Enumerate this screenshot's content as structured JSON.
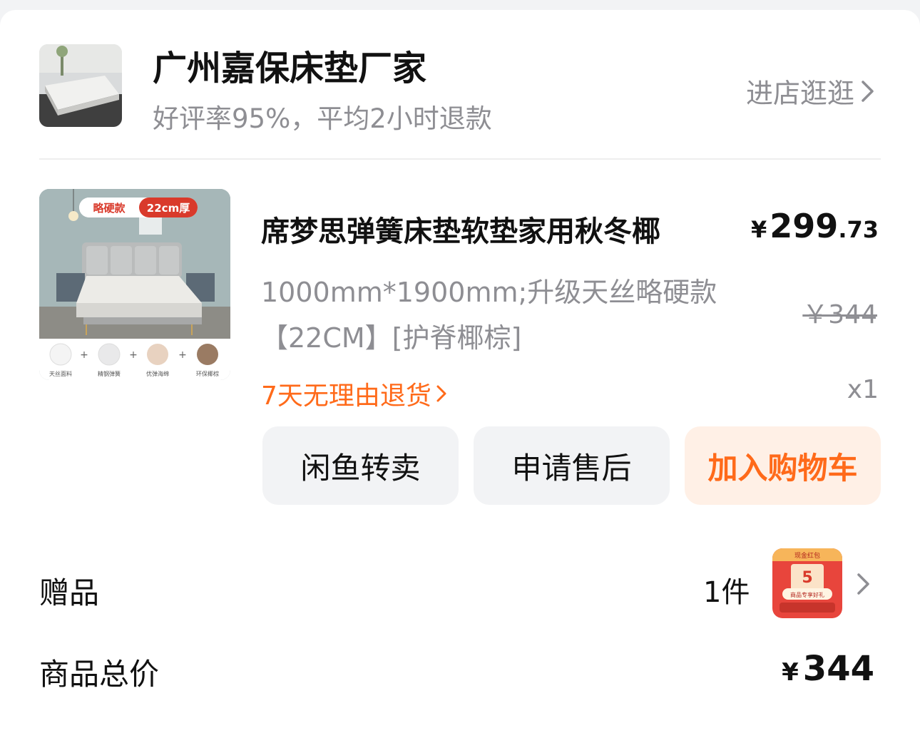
{
  "shop": {
    "name": "广州嘉保床垫厂家",
    "subtitle": "好评率95%，平均2小时退款",
    "enter_label": "进店逛逛"
  },
  "product": {
    "title": "席梦思弹簧床垫软垫家用秋冬椰",
    "price_currency": "¥",
    "price_int": "299",
    "price_dec": ".73",
    "spec": "1000mm*1900mm;升级天丝略硬款【22CM】[护脊椰棕]",
    "original_price": "￥344",
    "return_policy": "7天无理由退货",
    "quantity": "x1",
    "thumb": {
      "badge_left": "略硬款",
      "badge_right": "22cm厚",
      "features": [
        "天丝面料",
        "精钢弹簧",
        "优弹海绵",
        "环保椰棕"
      ]
    }
  },
  "actions": {
    "resell_label": "闲鱼转卖",
    "after_sales_label": "申请售后",
    "add_to_cart_label": "加入购物车"
  },
  "gift": {
    "label": "赠品",
    "count": "1件",
    "thumb_top": "现金红包",
    "thumb_number": "5",
    "thumb_caption": "商品专享好礼"
  },
  "total": {
    "label": "商品总价",
    "currency": "¥",
    "value": "344"
  },
  "colors": {
    "accent": "#ff6a1a",
    "accent_bg": "#fff0e6",
    "muted": "#8e8e93",
    "button_bg": "#f2f3f5"
  }
}
